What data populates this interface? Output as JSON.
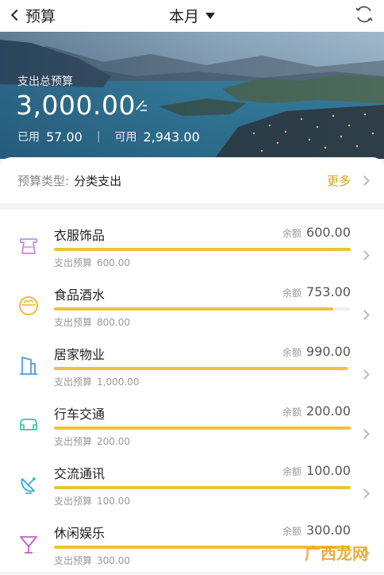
{
  "nav": {
    "back_label": "预算",
    "title": "本月"
  },
  "hero": {
    "label": "支出总预算",
    "total": "3,000.00",
    "used_label": "已用",
    "used_value": "57.00",
    "available_label": "可用",
    "available_value": "2,943.00"
  },
  "type_row": {
    "label": "预算类型:",
    "value": "分类支出",
    "more": "更多"
  },
  "categories": [
    {
      "name": "衣服饰品",
      "remaining_label": "余额",
      "remaining": "600.00",
      "budget_label": "支出预算",
      "budget": "600.00",
      "progress": 1.0,
      "icon": "clothing-icon",
      "color": "#c98be0"
    },
    {
      "name": "食品酒水",
      "remaining_label": "余额",
      "remaining": "753.00",
      "budget_label": "支出预算",
      "budget": "800.00",
      "progress": 0.94,
      "icon": "food-icon",
      "color": "#e8b820"
    },
    {
      "name": "居家物业",
      "remaining_label": "余额",
      "remaining": "990.00",
      "budget_label": "支出预算",
      "budget": "1,000.00",
      "progress": 0.99,
      "icon": "home-icon",
      "color": "#4a9fe0"
    },
    {
      "name": "行车交通",
      "remaining_label": "余额",
      "remaining": "200.00",
      "budget_label": "支出预算",
      "budget": "200.00",
      "progress": 1.0,
      "icon": "car-icon",
      "color": "#3cc8a0"
    },
    {
      "name": "交流通讯",
      "remaining_label": "余额",
      "remaining": "100.00",
      "budget_label": "支出预算",
      "budget": "100.00",
      "progress": 1.0,
      "icon": "satellite-icon",
      "color": "#3aa8d8"
    },
    {
      "name": "休闲娱乐",
      "remaining_label": "余额",
      "remaining": "300.00",
      "budget_label": "支出预算",
      "budget": "300.00",
      "progress": 1.0,
      "icon": "cocktail-icon",
      "color": "#c060c0"
    }
  ],
  "watermark": "广西龙网"
}
